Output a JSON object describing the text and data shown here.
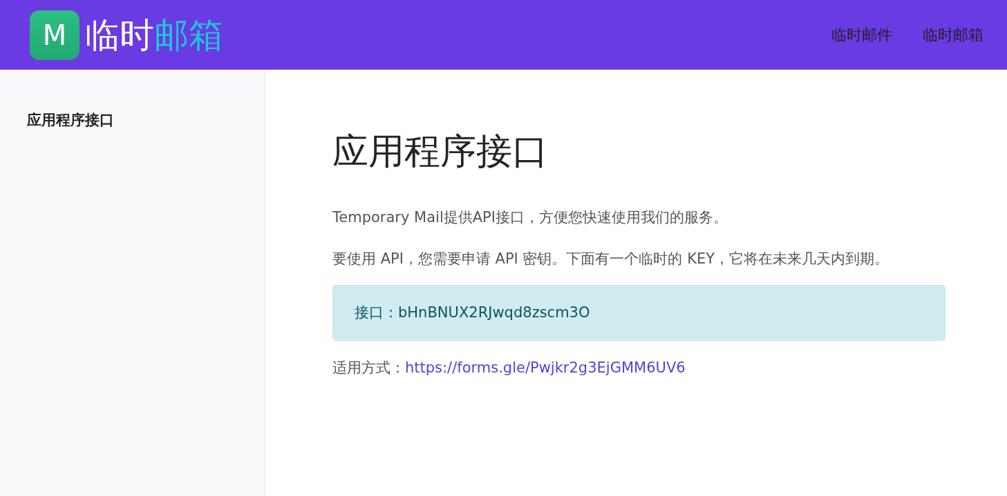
{
  "header": {
    "logo": {
      "mark": "M",
      "text_primary": "临时",
      "text_accent": "邮箱"
    },
    "nav": [
      {
        "label": "临时邮件"
      },
      {
        "label": "临时邮箱"
      }
    ]
  },
  "sidebar": {
    "items": [
      {
        "label": "应用程序接口",
        "selected": true
      }
    ]
  },
  "content": {
    "title": "应用程序接口",
    "paragraphs": [
      "Temporary Mail提供API接口，方便您快速使用我们的服务。",
      "要使用 API，您需要申请 API 密钥。下面有一个临时的 KEY，它将在未来几天内到期。"
    ],
    "key_box": "接口：bHnBNUX2RJwqd8zscm3O",
    "usage": {
      "label": "适用方式：",
      "link": "https://forms.gle/Pwjkr2g3EjGMM6UV6"
    }
  }
}
